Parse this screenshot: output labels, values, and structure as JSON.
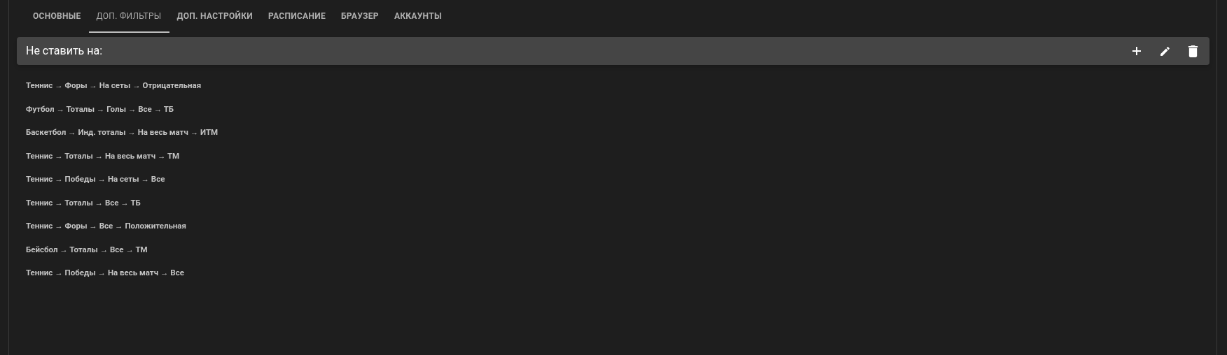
{
  "tabs": [
    {
      "label": "ОСНОВНЫЕ",
      "selected": false
    },
    {
      "label": "ДОП. ФИЛЬТРЫ",
      "selected": true
    },
    {
      "label": "ДОП. НАСТРОЙКИ",
      "selected": false
    },
    {
      "label": "РАСПИСАНИЕ",
      "selected": false
    },
    {
      "label": "БРАУЗЕР",
      "selected": false
    },
    {
      "label": "АККАУНТЫ",
      "selected": false
    }
  ],
  "toolbar": {
    "title": "Не ставить на:"
  },
  "rules": [
    {
      "text": "Теннис → Форы → На сеты → Отрицательная"
    },
    {
      "text": "Футбол → Тоталы → Голы → Все → ТБ"
    },
    {
      "text": "Баскетбол → Инд. тоталы → На весь матч → ИТМ"
    },
    {
      "text": "Теннис → Тоталы → На весь матч → ТМ"
    },
    {
      "text": "Теннис → Победы → На сеты → Все"
    },
    {
      "text": "Теннис → Тоталы → Все → ТБ"
    },
    {
      "text": "Теннис → Форы → Все → Положительная"
    },
    {
      "text": "Бейсбол → Тоталы → Все → ТМ"
    },
    {
      "text": "Теннис → Победы → На весь матч → Все"
    }
  ]
}
